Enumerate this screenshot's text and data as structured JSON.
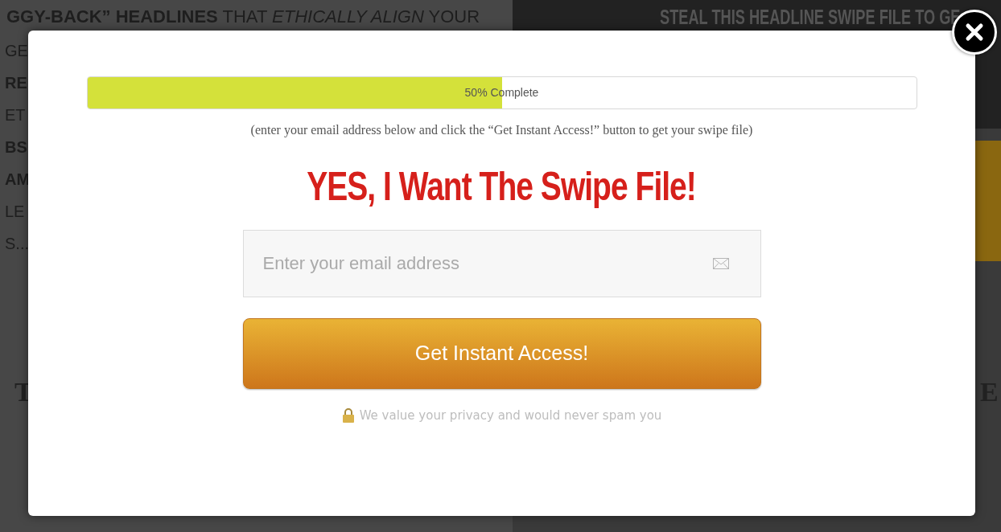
{
  "background": {
    "headline": "**GGY-BACK” HEADLINES** THAT *ETHICALLY ALIGN* YOUR",
    "side_fragments": [
      "GE",
      "RE",
      "ET",
      "BS",
      "AM",
      "LE",
      "S..."
    ],
    "banner": "STEAL THIS HEADLINE SWIPE FILE TO GE",
    "big_left": "T",
    "big_right": "E"
  },
  "modal": {
    "progress": {
      "level": 0.5,
      "label": "50% Complete"
    },
    "hint": "(enter your email address below and click the “Get Instant Access!” button to get your swipe file)",
    "headline": "YES, I Want The Swipe File!",
    "email": {
      "placeholder": "Enter your email address"
    },
    "button": "Get Instant Access!",
    "privacy": "We value your privacy and would never spam you"
  }
}
